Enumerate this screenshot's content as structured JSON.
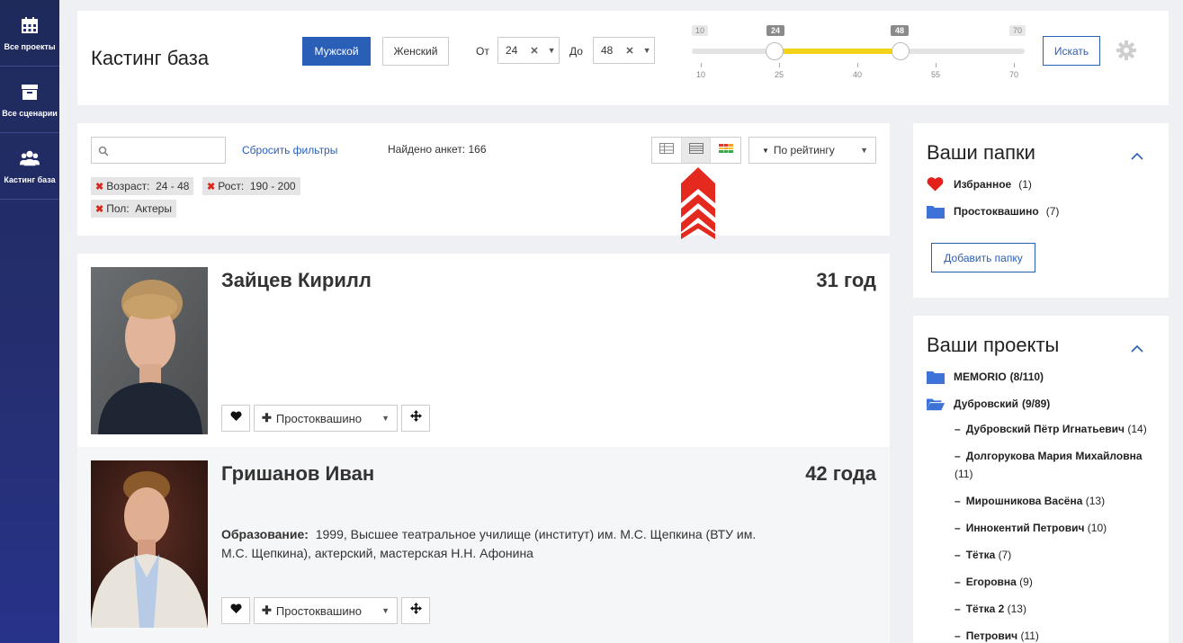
{
  "sidebar": {
    "items": [
      {
        "label": "Все проекты",
        "icon": "calendar-icon"
      },
      {
        "label": "Все сценарии",
        "icon": "archive-icon"
      },
      {
        "label": "Кастинг база",
        "icon": "users-icon"
      }
    ]
  },
  "header": {
    "title": "Кастинг база",
    "male_label": "Мужской",
    "female_label": "Женский",
    "from_label": "От",
    "to_label": "До",
    "age_from": "24",
    "age_to": "48",
    "search_label": "Искать",
    "slider": {
      "min": "10",
      "max": "70",
      "low": "24",
      "high": "48",
      "ticks": [
        "10",
        "25",
        "40",
        "55",
        "70"
      ]
    }
  },
  "filters": {
    "search_placeholder": "",
    "reset_label": "Сбросить фильтры",
    "found_text": "Найдено анкет: 166",
    "sort_label": "По рейтингу",
    "chips": [
      {
        "label": "Возраст:  24 - 48"
      },
      {
        "label": "Рост:  190 - 200"
      },
      {
        "label": "Пол:  Актеры"
      }
    ]
  },
  "cards": [
    {
      "name": "Зайцев Кирилл",
      "age": "31 год",
      "folder": "Простоквашино"
    },
    {
      "name": "Гришанов Иван",
      "age": "42 года",
      "edu_label": "Образование:",
      "edu_text": "1999, Высшее театральное училище (институт) им. М.С. Щепкина (ВТУ им. М.С. Щепкина), актерский, мастерская Н.Н. Афонина",
      "folder": "Простоквашино"
    }
  ],
  "folders_panel": {
    "title": "Ваши папки",
    "items": [
      {
        "name": "Избранное",
        "count": "(1)"
      },
      {
        "name": "Простоквашино",
        "count": "(7)"
      }
    ],
    "add_label": "Добавить папку"
  },
  "projects_panel": {
    "title": "Ваши проекты",
    "projects": [
      {
        "name": "MEMORIO",
        "count": "(8/110)"
      },
      {
        "name": "Дубровский",
        "count": "(9/89)"
      }
    ],
    "subitems": [
      {
        "name": "Дубровский Пётр Игнатьевич",
        "count": "(14)"
      },
      {
        "name": "Долгорукова Мария Михайловна",
        "count": "(11)"
      },
      {
        "name": "Мирошникова Васёна",
        "count": "(13)"
      },
      {
        "name": "Иннокентий Петрович",
        "count": "(10)"
      },
      {
        "name": "Тётка",
        "count": "(7)"
      },
      {
        "name": "Егоровна",
        "count": "(9)"
      },
      {
        "name": "Тётка 2",
        "count": "(13)"
      },
      {
        "name": "Петрович",
        "count": "(11)"
      }
    ]
  },
  "colors": {
    "primary": "#2a5fb7",
    "slider_fill": "#f3d31a",
    "sidebar": "#252f72",
    "heart": "#e3201b",
    "folder": "#3d72d6"
  }
}
